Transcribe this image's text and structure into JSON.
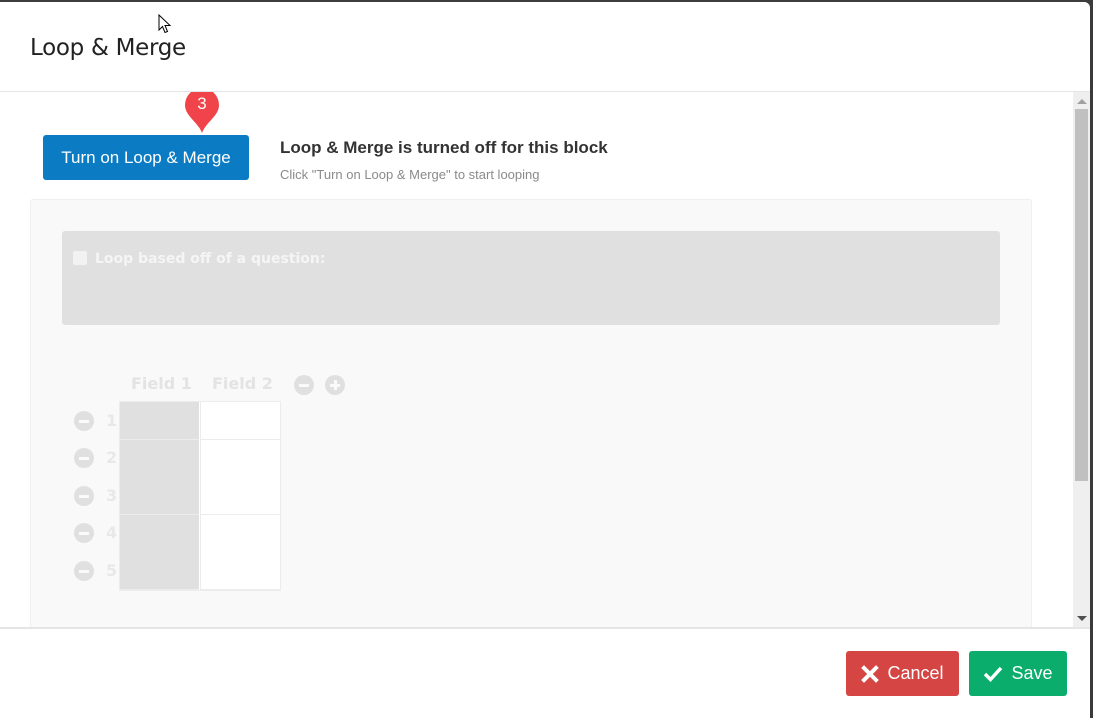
{
  "modal": {
    "title": "Loop & Merge"
  },
  "body": {
    "turn_on_button": "Turn on Loop & Merge",
    "callout_number": "3",
    "status_title": "Loop & Merge is turned off for this block",
    "status_subtitle": "Click \"Turn on Loop & Merge\" to start looping",
    "question_option_label": "Loop based off of a question:",
    "question_option_checked": false,
    "fields": {
      "headers": [
        "Field 1",
        "Field 2"
      ],
      "rows": [
        {
          "number": "1",
          "field1": "",
          "field2": ""
        },
        {
          "number": "2",
          "field1": "",
          "field2": ""
        },
        {
          "number": "3",
          "field1": "",
          "field2": ""
        },
        {
          "number": "4",
          "field1": "",
          "field2": ""
        },
        {
          "number": "5",
          "field1": "",
          "field2": ""
        }
      ]
    }
  },
  "footer": {
    "cancel_label": "Cancel",
    "save_label": "Save"
  },
  "colors": {
    "primary": "#0b7cc4",
    "cancel": "#d44543",
    "save": "#0aad6c",
    "callout": "#f0434a"
  }
}
